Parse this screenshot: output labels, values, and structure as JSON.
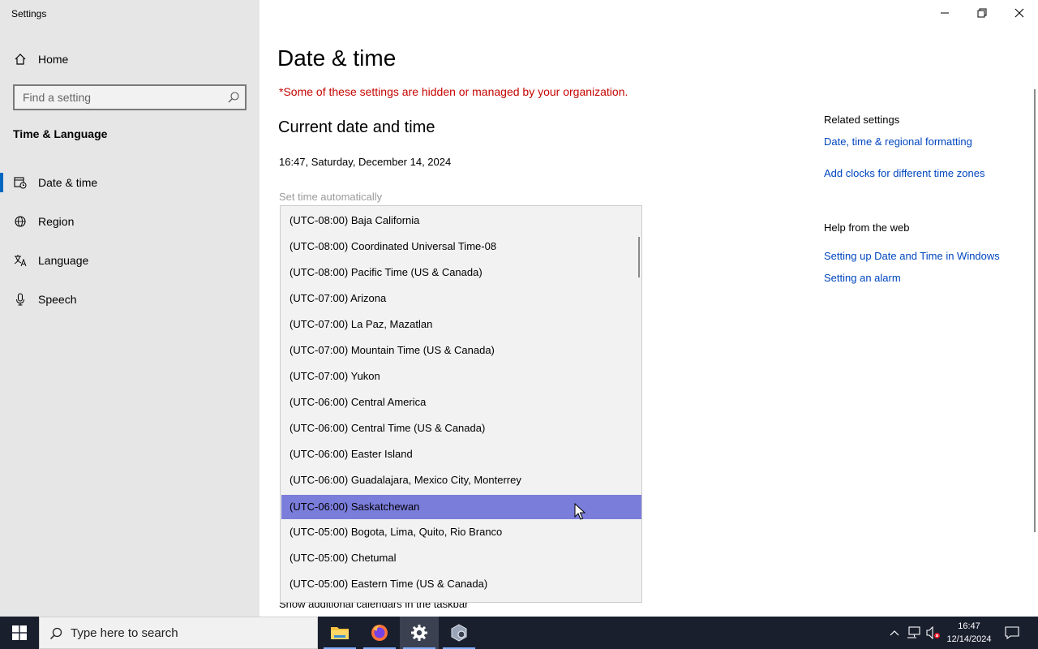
{
  "window": {
    "title": "Settings"
  },
  "sidebar": {
    "home_label": "Home",
    "search_placeholder": "Find a setting",
    "section_title": "Time & Language",
    "items": [
      {
        "label": "Date & time",
        "icon": "calendar-clock-icon",
        "active": true
      },
      {
        "label": "Region",
        "icon": "globe-icon"
      },
      {
        "label": "Language",
        "icon": "language-icon"
      },
      {
        "label": "Speech",
        "icon": "microphone-icon"
      }
    ]
  },
  "main": {
    "title": "Date & time",
    "org_warning": "*Some of these settings are hidden or managed by your organization.",
    "current_heading": "Current date and time",
    "current_time": "16:47, Saturday, December 14, 2024",
    "set_time_auto_label": "Set time automatically",
    "show_calendars_label": "Show additional calendars in the taskbar"
  },
  "timezone_dropdown": {
    "selected": "(UTC-06:00) Saskatchewan",
    "options": [
      "(UTC-08:00) Baja California",
      "(UTC-08:00) Coordinated Universal Time-08",
      "(UTC-08:00) Pacific Time (US & Canada)",
      "(UTC-07:00) Arizona",
      "(UTC-07:00) La Paz, Mazatlan",
      "(UTC-07:00) Mountain Time (US & Canada)",
      "(UTC-07:00) Yukon",
      "(UTC-06:00) Central America",
      "(UTC-06:00) Central Time (US & Canada)",
      "(UTC-06:00) Easter Island",
      "(UTC-06:00) Guadalajara, Mexico City, Monterrey",
      "(UTC-06:00) Saskatchewan",
      "(UTC-05:00) Bogota, Lima, Quito, Rio Branco",
      "(UTC-05:00) Chetumal",
      "(UTC-05:00) Eastern Time (US & Canada)"
    ]
  },
  "related": {
    "title": "Related settings",
    "links": [
      "Date, time & regional formatting",
      "Add clocks for different time zones"
    ]
  },
  "help": {
    "title": "Help from the web",
    "links": [
      "Setting up Date and Time in Windows",
      "Setting an alarm"
    ]
  },
  "taskbar": {
    "search_placeholder": "Type here to search",
    "time": "16:47",
    "date": "12/14/2024",
    "apps": [
      "file-explorer-icon",
      "firefox-icon",
      "settings-gear-icon",
      "app-icon"
    ]
  },
  "colors": {
    "accent": "#0067c0",
    "selection": "#7b7ddb",
    "warning": "#c50500",
    "link": "#0046bf",
    "taskbar": "#1a1f2e"
  }
}
